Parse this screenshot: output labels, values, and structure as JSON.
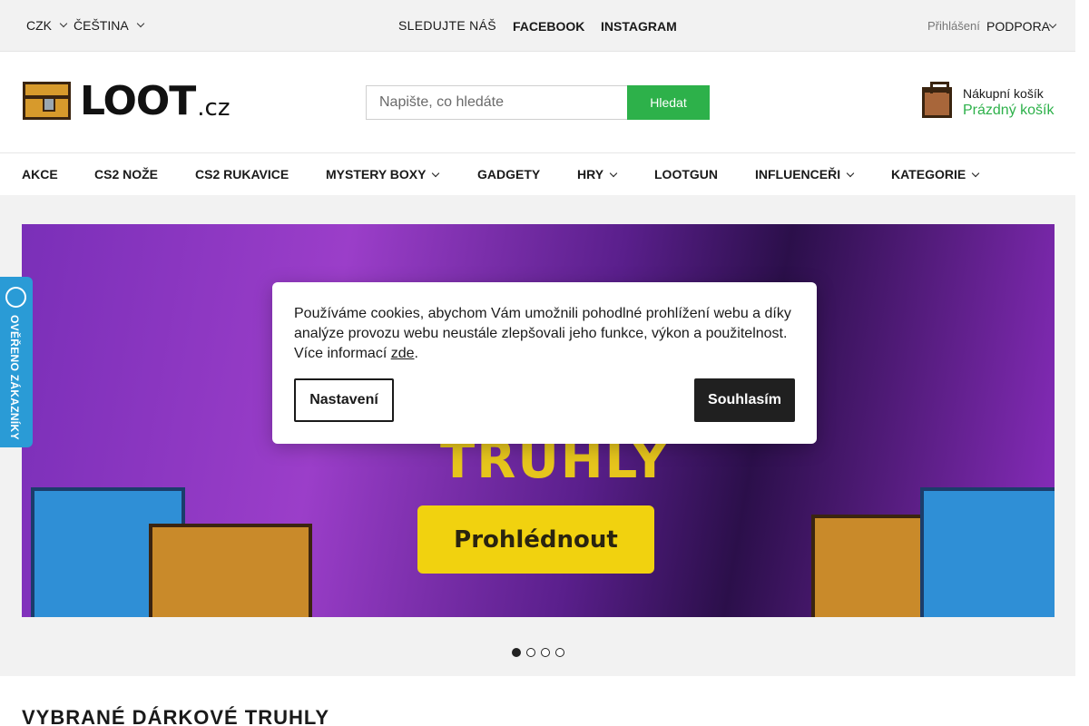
{
  "topbar": {
    "currency": "CZK",
    "language": "ČEŠTINA",
    "follow_label": "SLEDUJTE NÁŠ",
    "facebook": "FACEBOOK",
    "instagram": "INSTAGRAM",
    "login": "Přihlášení",
    "support": "PODPORA"
  },
  "header": {
    "logo_main": "LOOT",
    "logo_tld": ".cz",
    "search_placeholder": "Napište, co hledáte",
    "search_button": "Hledat",
    "cart_title": "Nákupní košík",
    "cart_status": "Prázdný košík"
  },
  "nav": {
    "items": [
      {
        "label": "AKCE",
        "dropdown": false
      },
      {
        "label": "CS2 NOŽE",
        "dropdown": false
      },
      {
        "label": "CS2 RUKAVICE",
        "dropdown": false
      },
      {
        "label": "MYSTERY BOXY",
        "dropdown": true
      },
      {
        "label": "GADGETY",
        "dropdown": false
      },
      {
        "label": "HRY",
        "dropdown": true
      },
      {
        "label": "LOOTGUN",
        "dropdown": false
      },
      {
        "label": "INFLUENCEŘI",
        "dropdown": true
      },
      {
        "label": "KATEGORIE",
        "dropdown": true
      }
    ]
  },
  "banner": {
    "title": "TRUHLY",
    "cta": "Prohlédnout",
    "slides_total": 4,
    "active_slide": 1
  },
  "verified": {
    "label": "OVĚŘENO ZÁKAZNÍKY"
  },
  "cookie": {
    "text": "Používáme cookies, abychom Vám umožnili pohodlné prohlížení webu a díky analýze provozu webu neustále zlepšovali jeho funkce, výkon a použitelnost. Více informací ",
    "link": "zde",
    "after_link": ".",
    "settings_button": "Nastavení",
    "agree_button": "Souhlasím"
  },
  "section": {
    "title": "VYBRANÉ DÁRKOVÉ TRUHLY"
  },
  "colors": {
    "accent_green": "#2db14a",
    "cta_yellow": "#f1d20f",
    "verified_blue": "#2a9bd6"
  }
}
